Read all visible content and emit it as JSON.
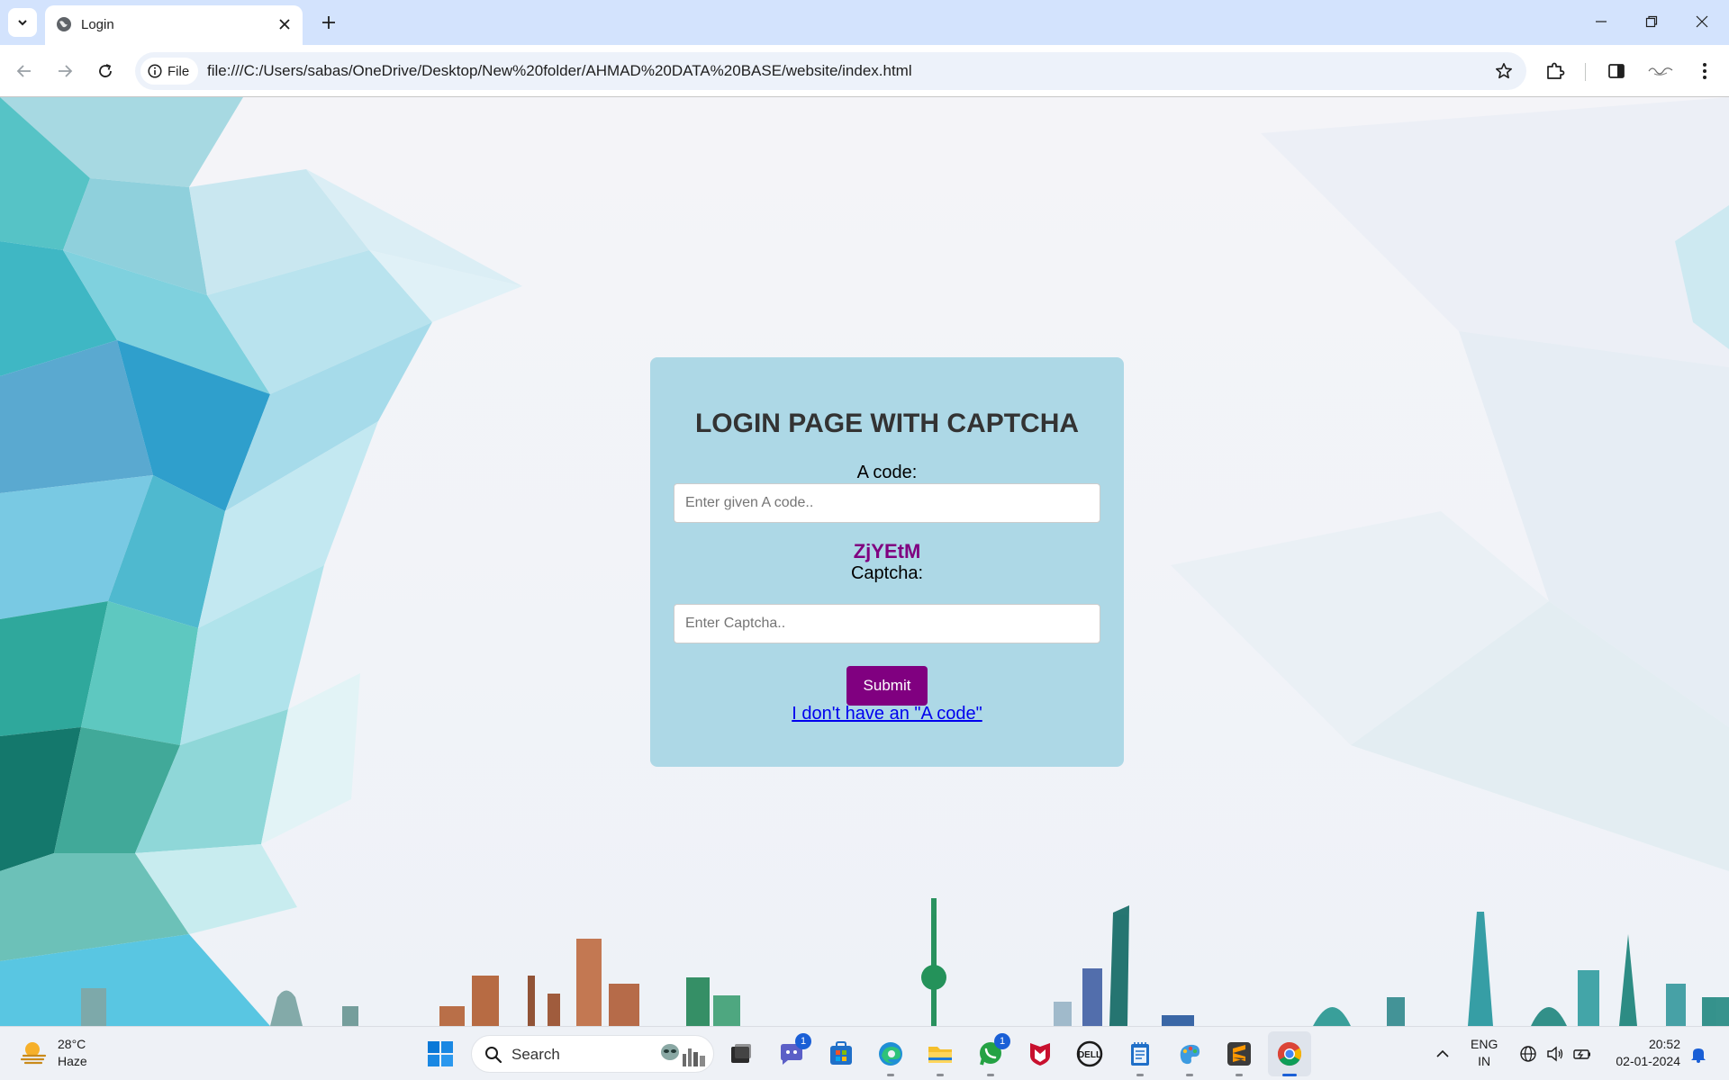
{
  "browser": {
    "tab_title": "Login",
    "site_chip_label": "File",
    "url": "file:///C:/Users/sabas/OneDrive/Desktop/New%20folder/AHMAD%20DATA%20BASE/website/index.html"
  },
  "login": {
    "title": "LOGIN PAGE WITH CAPTCHA",
    "a_code_label": "A code:",
    "a_code_placeholder": "Enter given A code..",
    "captcha_code": "ZjYEtM",
    "captcha_label": "Captcha:",
    "captcha_placeholder": "Enter Captcha..",
    "submit_label": "Submit",
    "no_code_link": "I don't have an \"A code\""
  },
  "taskbar": {
    "weather_temp": "28°C",
    "weather_condition": "Haze",
    "search_label": "Search",
    "teams_badge": "1",
    "whatsapp_badge": "1",
    "lang_primary": "ENG",
    "lang_secondary": "IN",
    "time": "20:52",
    "date": "02-01-2024"
  },
  "colors": {
    "card_bg": "#add8e6",
    "accent": "#800080",
    "link": "#0000ee",
    "chrome_tabbar": "#d3e3fd"
  }
}
